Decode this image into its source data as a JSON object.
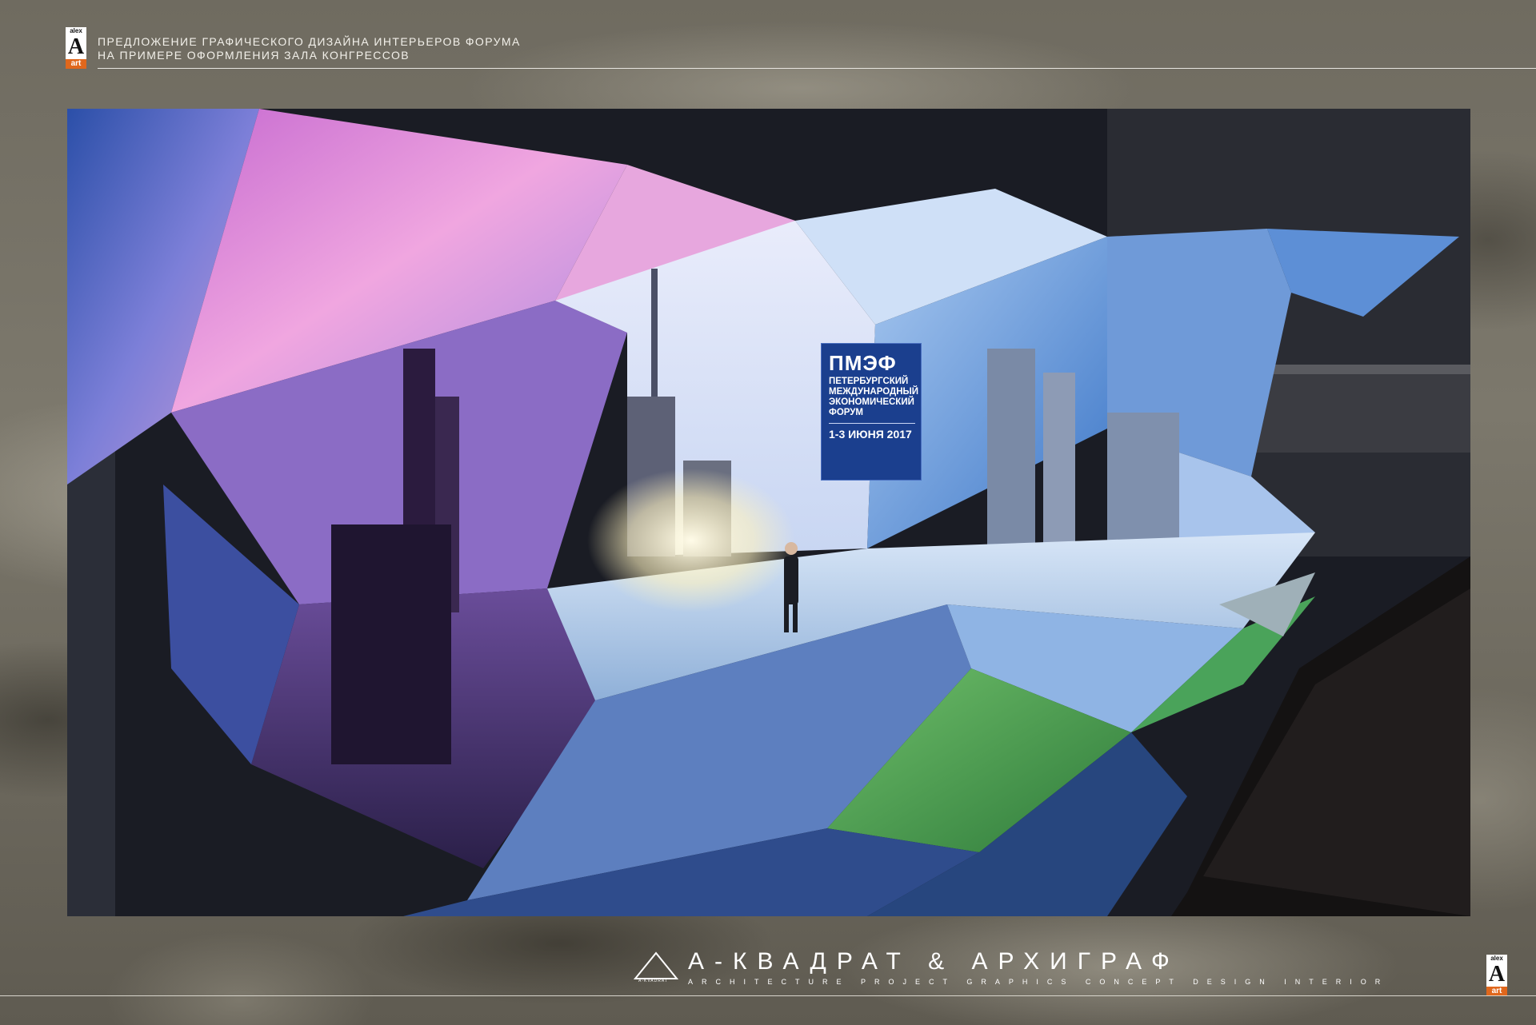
{
  "header": {
    "logo": {
      "top": "alex",
      "letter": "A",
      "bottom": "art"
    },
    "title_line1": "ПРЕДЛОЖЕНИЕ ГРАФИЧЕСКОГО ДИЗАЙНА ИНТЕРЬЕРОВ ФОРУМА",
    "title_line2": "НА ПРИМЕРЕ ОФОРМЛЕНИЯ ЗАЛА КОНГРЕССОВ"
  },
  "stage_sign": {
    "acronym": "ПМЭФ",
    "line1": "ПЕТЕРБУРГСКИЙ",
    "line2": "МЕЖДУНАРОДНЫЙ",
    "line3": "ЭКОНОМИЧЕСКИЙ",
    "line4": "ФОРУМ",
    "date": "1-3 ИЮНЯ 2017",
    "color": "#1b3f8e"
  },
  "footer": {
    "brand_name": "А-КВАДРАТ & АРХИГРАФ",
    "tagline": "ARCHITECTURE PROJECT GRAPHICS CONCEPT DESIGN INTERIOR",
    "mark_text": "A-KVADRAT",
    "logo": {
      "top": "alex",
      "letter": "A",
      "bottom": "art"
    }
  },
  "colors": {
    "accent": "#e0671c",
    "rule": "#e8e6e0"
  }
}
